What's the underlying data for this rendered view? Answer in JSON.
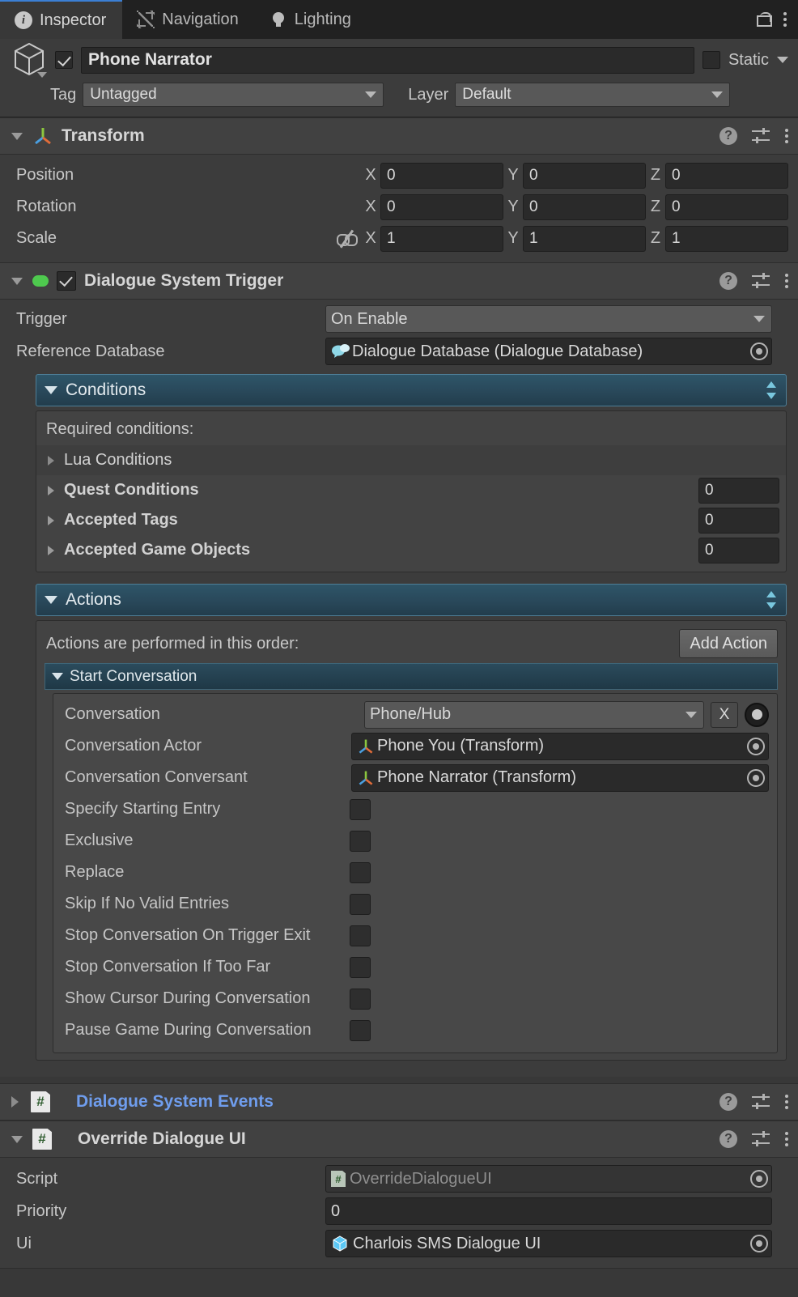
{
  "window": {
    "tabs": [
      {
        "label": "Inspector",
        "icon": "info-icon",
        "active": true
      },
      {
        "label": "Navigation",
        "icon": "navigation-icon",
        "active": false
      },
      {
        "label": "Lighting",
        "icon": "lightbulb-icon",
        "active": false
      }
    ],
    "lock_icon": "unlocked-padlock-icon",
    "menu_icon": "kebab-menu-icon"
  },
  "gameobject": {
    "icon": "cube-icon",
    "enabled": true,
    "name": "Phone Narrator",
    "static_label": "Static",
    "static_checked": false,
    "tag_label": "Tag",
    "tag_value": "Untagged",
    "layer_label": "Layer",
    "layer_value": "Default"
  },
  "transform": {
    "title": "Transform",
    "icon": "transform-axis-icon",
    "rows": [
      {
        "label": "Position",
        "x": "0",
        "y": "0",
        "z": "0"
      },
      {
        "label": "Rotation",
        "x": "0",
        "y": "0",
        "z": "0"
      },
      {
        "label": "Scale",
        "x": "1",
        "y": "1",
        "z": "1",
        "link": "broken-link-icon"
      }
    ],
    "axes": {
      "x": "X",
      "y": "Y",
      "z": "Z"
    }
  },
  "dialogue_system_trigger": {
    "title": "Dialogue System Trigger",
    "enabled": true,
    "trigger_label": "Trigger",
    "trigger_value": "On Enable",
    "reference_db_label": "Reference Database",
    "reference_db_value": "Dialogue Database (Dialogue Database)",
    "reference_db_icon": "speech-bubble-icon",
    "conditions": {
      "header": "Conditions",
      "note": "Required conditions:",
      "rows": [
        {
          "label": "Lua Conditions",
          "count": null,
          "bold": false
        },
        {
          "label": "Quest Conditions",
          "count": "0",
          "bold": true
        },
        {
          "label": "Accepted Tags",
          "count": "0",
          "bold": true
        },
        {
          "label": "Accepted Game Objects",
          "count": "0",
          "bold": true
        }
      ]
    },
    "actions": {
      "header": "Actions",
      "note": "Actions are performed in this order:",
      "add_button": "Add Action",
      "start_conversation": {
        "header": "Start Conversation",
        "conversation_label": "Conversation",
        "conversation_value": "Phone/Hub",
        "clear_button": "X",
        "conversation_actor_label": "Conversation Actor",
        "conversation_actor_value": "Phone You (Transform)",
        "conversation_conversant_label": "Conversation Conversant",
        "conversation_conversant_value": "Phone Narrator (Transform)",
        "checkboxes": [
          {
            "label": "Specify Starting Entry",
            "checked": false
          },
          {
            "label": "Exclusive",
            "checked": false
          },
          {
            "label": "Replace",
            "checked": false
          },
          {
            "label": "Skip If No Valid Entries",
            "checked": false
          },
          {
            "label": "Stop Conversation On Trigger Exit",
            "checked": false
          },
          {
            "label": "Stop Conversation If Too Far",
            "checked": false
          },
          {
            "label": "Show Cursor During Conversation",
            "checked": false
          },
          {
            "label": "Pause Game During Conversation",
            "checked": false
          }
        ]
      }
    }
  },
  "dialogue_system_events": {
    "title": "Dialogue System Events",
    "expanded": false
  },
  "override_dialogue_ui": {
    "title": "Override Dialogue UI",
    "expanded": true,
    "script_label": "Script",
    "script_value": "OverrideDialogueUI",
    "priority_label": "Priority",
    "priority_value": "0",
    "ui_label": "Ui",
    "ui_value": "Charlois SMS Dialogue UI"
  },
  "colors": {
    "background": "#383838",
    "panel": "#3c3c3c",
    "header": "#414141",
    "accent_tab": "#3b7fd4",
    "section_blue": "#2e5568",
    "link_blue": "#6f9ded",
    "enabled_green": "#4ec94e"
  }
}
